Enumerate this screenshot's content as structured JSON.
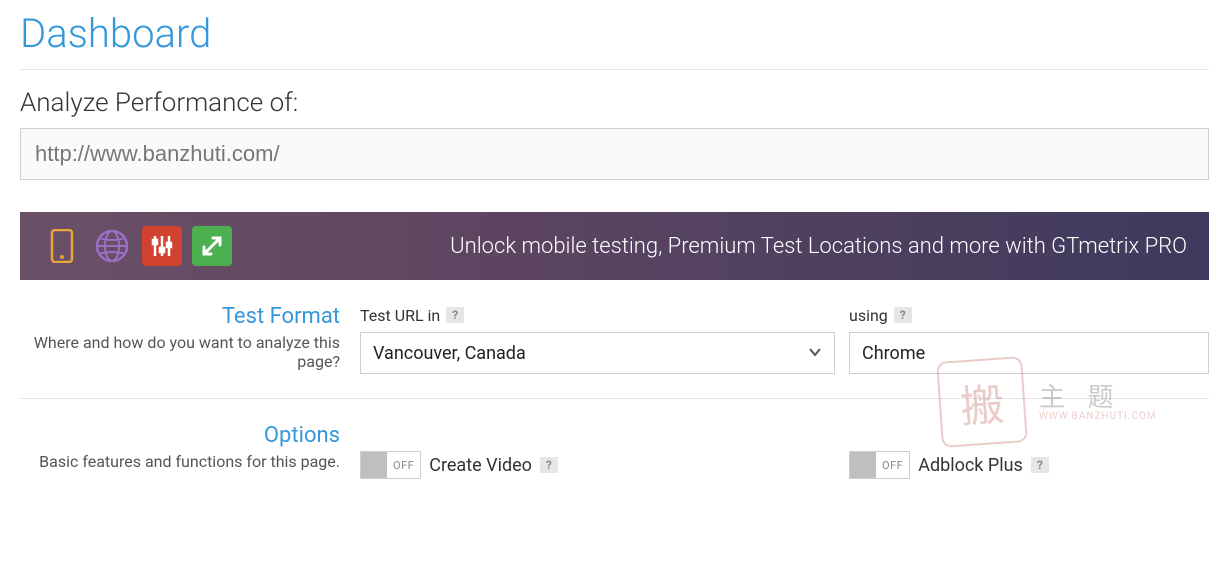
{
  "page_title": "Dashboard",
  "analyze_label": "Analyze Performance of:",
  "url_value": "http://www.banzhuti.com/",
  "promo_text": "Unlock mobile testing, Premium Test Locations and more with GTmetrix PRO",
  "rows": {
    "test_format": {
      "title": "Test Format",
      "desc": "Where and how do you want to analyze this page?",
      "location_label": "Test URL in",
      "location_value": "Vancouver, Canada",
      "browser_label": "using",
      "browser_value": "Chrome"
    },
    "options": {
      "title": "Options",
      "desc": "Basic features and functions for this page.",
      "video_label": "Create Video",
      "video_state": "OFF",
      "adblock_label": "Adblock Plus",
      "adblock_state": "OFF"
    }
  },
  "watermark": {
    "seal": "搬",
    "line1": "主 题",
    "line2": "WWW.BANZHUTI.COM"
  }
}
